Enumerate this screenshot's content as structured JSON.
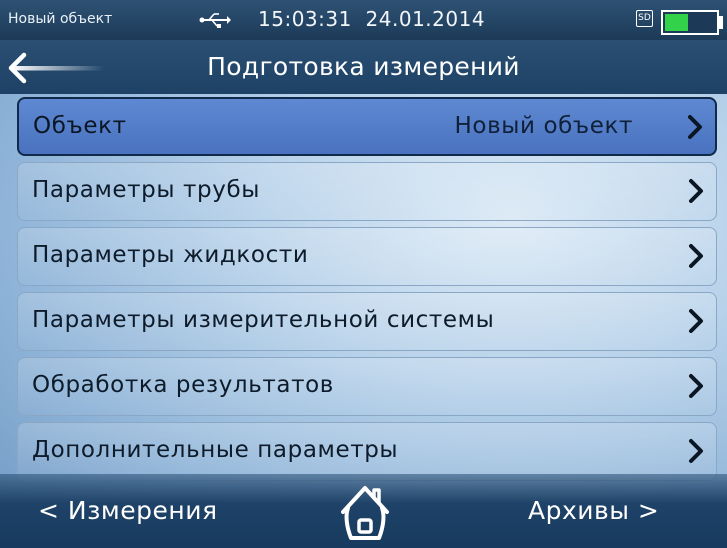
{
  "status": {
    "object_name": "Новый объект",
    "time": "15:03:31",
    "date": "24.01.2014",
    "sd_label": "SD",
    "battery_level": 0.5,
    "battery_color": "#32d24a"
  },
  "header": {
    "title": "Подготовка измерений",
    "back_icon": "arrow-left-icon"
  },
  "menu": {
    "items": [
      {
        "label": "Объект",
        "value": "Новый объект",
        "selected": true
      },
      {
        "label": "Параметры трубы"
      },
      {
        "label": "Параметры жидкости"
      },
      {
        "label": "Параметры измерительной системы"
      },
      {
        "label": "Обработка результатов"
      },
      {
        "label": "Дополнительные параметры"
      }
    ]
  },
  "footer": {
    "left_label": "< Измерения",
    "right_label": "Архивы >",
    "home_icon": "home-icon"
  },
  "colors": {
    "selected_item": "#5478c8",
    "title_bar": "#1e4266"
  }
}
